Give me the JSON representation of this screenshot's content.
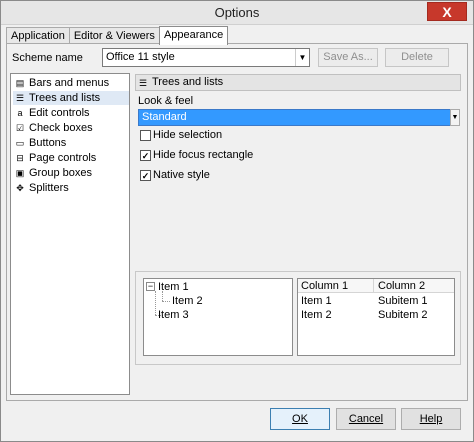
{
  "window": {
    "title": "Options",
    "close_glyph": "X"
  },
  "tabs": [
    {
      "label": "Application",
      "active": false
    },
    {
      "label": "Editor & Viewers",
      "active": false
    },
    {
      "label": "Appearance",
      "active": true
    }
  ],
  "scheme": {
    "label": "Scheme name",
    "value": "Office 11 style",
    "save_as": "Save As...",
    "delete": "Delete"
  },
  "nav": {
    "items": [
      {
        "label": "Bars and menus",
        "icon": "toolbar-icon",
        "selected": false
      },
      {
        "label": "Trees and lists",
        "icon": "tree-list-icon",
        "selected": true
      },
      {
        "label": "Edit controls",
        "icon": "edit-control-icon",
        "selected": false
      },
      {
        "label": "Check boxes",
        "icon": "checkbox-icon",
        "selected": false
      },
      {
        "label": "Buttons",
        "icon": "button-icon",
        "selected": false
      },
      {
        "label": "Page controls",
        "icon": "page-control-icon",
        "selected": false
      },
      {
        "label": "Group boxes",
        "icon": "group-box-icon",
        "selected": false
      },
      {
        "label": "Splitters",
        "icon": "splitter-icon",
        "selected": false
      }
    ]
  },
  "section": {
    "title": "Trees and lists",
    "lookfeel_label": "Look & feel",
    "lookfeel_value": "Standard",
    "options": [
      {
        "label": "Hide selection",
        "checked": false
      },
      {
        "label": "Hide focus rectangle",
        "checked": true
      },
      {
        "label": "Native style",
        "checked": true
      }
    ]
  },
  "preview": {
    "tree": [
      "Item 1",
      "Item 2",
      "Item 3"
    ],
    "list": {
      "columns": [
        "Column 1",
        "Column 2"
      ],
      "rows": [
        [
          "Item 1",
          "Subitem 1"
        ],
        [
          "Item 2",
          "Subitem 2"
        ]
      ]
    }
  },
  "buttons": {
    "ok": "OK",
    "cancel": "Cancel",
    "help": "Help"
  },
  "colors": {
    "selection": "#3399ff",
    "close": "#c7382b"
  }
}
